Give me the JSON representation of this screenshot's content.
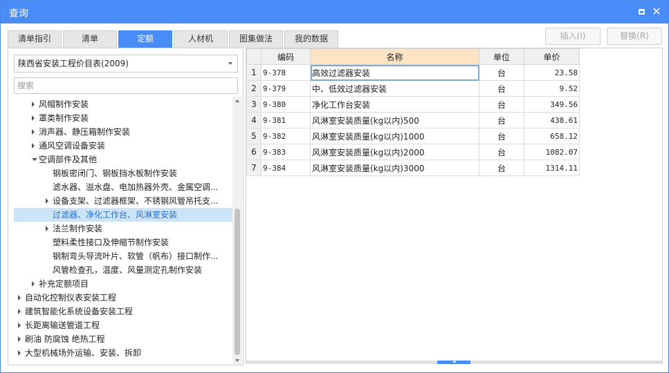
{
  "window": {
    "title": "查询"
  },
  "tabs": [
    {
      "label": "清单指引",
      "active": false
    },
    {
      "label": "清单",
      "active": false
    },
    {
      "label": "定额",
      "active": true
    },
    {
      "label": "人材机",
      "active": false
    },
    {
      "label": "图集做法",
      "active": false
    },
    {
      "label": "我的数据",
      "active": false
    }
  ],
  "actions": {
    "insert_label": "插入(I)",
    "replace_label": "替换(R)"
  },
  "left": {
    "library_selected": "陕西省安装工程价目表(2009)",
    "search_placeholder": "搜索",
    "tree": [
      {
        "label": "风帽制作安装",
        "arrow": "right",
        "level": 1
      },
      {
        "label": "罩类制作安装",
        "arrow": "right",
        "level": 1
      },
      {
        "label": "消声器、静压箱制作安装",
        "arrow": "right",
        "level": 1
      },
      {
        "label": "通风空调设备安装",
        "arrow": "right",
        "level": 1
      },
      {
        "label": "空调部件及其他",
        "arrow": "down",
        "level": 1
      },
      {
        "label": "钢板密闭门、钢板挡水板制作安装",
        "arrow": "",
        "level": 2
      },
      {
        "label": "滤水器、溢水盘、电加热器外壳、金属空调...",
        "arrow": "",
        "level": 2
      },
      {
        "label": "设备支架、过滤器框架、不锈钢风管吊托支...",
        "arrow": "right",
        "level": 2
      },
      {
        "label": "过滤器、净化工作台、风淋室安装",
        "arrow": "",
        "level": 2,
        "selected": true
      },
      {
        "label": "法兰制作安装",
        "arrow": "right",
        "level": 2
      },
      {
        "label": "塑料柔性接口及伸缩节制作安装",
        "arrow": "",
        "level": 2
      },
      {
        "label": "钢制弯头导流叶片、软管（帆布）接口制作...",
        "arrow": "",
        "level": 2
      },
      {
        "label": "风管检查孔，温度、风量测定孔制作安装",
        "arrow": "",
        "level": 2
      },
      {
        "label": "补充定额项目",
        "arrow": "right",
        "level": 1
      },
      {
        "label": "自动化控制仪表安装工程",
        "arrow": "right",
        "level": 0
      },
      {
        "label": "建筑智能化系统设备安装工程",
        "arrow": "right",
        "level": 0
      },
      {
        "label": "长距离输送管道工程",
        "arrow": "right",
        "level": 0
      },
      {
        "label": "刷油 防腐蚀 绝热工程",
        "arrow": "right",
        "level": 0
      },
      {
        "label": "大型机械场外运输、安装、拆卸",
        "arrow": "right",
        "level": 0
      }
    ]
  },
  "grid": {
    "headers": {
      "code": "编码",
      "name": "名称",
      "unit": "单位",
      "price": "单价"
    },
    "rows": [
      {
        "no": "1",
        "code": "9-378",
        "name": "高效过滤器安装",
        "unit": "台",
        "price": "23.58"
      },
      {
        "no": "2",
        "code": "9-379",
        "name": "中、低效过滤器安装",
        "unit": "台",
        "price": "9.52"
      },
      {
        "no": "3",
        "code": "9-380",
        "name": "净化工作台安装",
        "unit": "台",
        "price": "349.56"
      },
      {
        "no": "4",
        "code": "9-381",
        "name": "风淋室安装质量(kg以内)500",
        "unit": "台",
        "price": "438.61"
      },
      {
        "no": "5",
        "code": "9-382",
        "name": "风淋室安装质量(kg以内)1000",
        "unit": "台",
        "price": "658.12"
      },
      {
        "no": "6",
        "code": "9-383",
        "name": "风淋室安装质量(kg以内)2000",
        "unit": "台",
        "price": "1082.07"
      },
      {
        "no": "7",
        "code": "9-384",
        "name": "风淋室安装质量(kg以内)3000",
        "unit": "台",
        "price": "1314.11"
      }
    ]
  }
}
